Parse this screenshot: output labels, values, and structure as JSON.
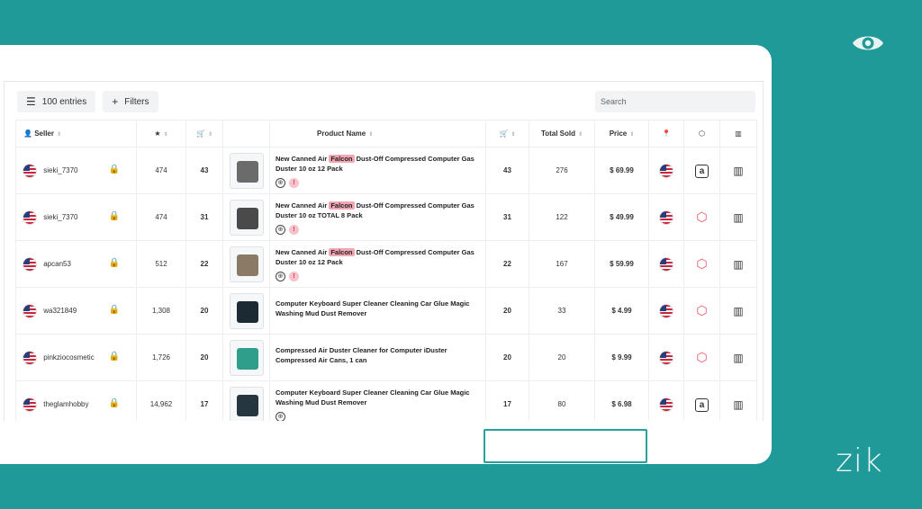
{
  "toolbar": {
    "entries_label": "100 entries",
    "filters_label": "Filters",
    "search_placeholder": "Search"
  },
  "columns": {
    "seller": "Seller",
    "product": "Product Name",
    "total_sold": "Total Sold",
    "price": "Price"
  },
  "rows": [
    {
      "seller": "sieki_7370",
      "rating": "474",
      "carts": "43",
      "title_pre": "New Canned Air ",
      "title_hl": "Falcon",
      "title_post": " Dust-Off Compressed Computer Gas Duster 10 oz 12 Pack",
      "sales": "43",
      "total_sold": "276",
      "price": "$ 69.99",
      "fulfillment": "amazon-icon",
      "badges": 2
    },
    {
      "seller": "sieki_7370",
      "rating": "474",
      "carts": "31",
      "title_pre": "New Canned Air ",
      "title_hl": "Falcon",
      "title_post": " Dust-Off Compressed Computer Gas Duster 10 oz TOTAL 8 Pack",
      "sales": "31",
      "total_sold": "122",
      "price": "$ 49.99",
      "fulfillment": "box-icon",
      "badges": 2
    },
    {
      "seller": "apcan53",
      "rating": "512",
      "carts": "22",
      "title_pre": "New Canned Air ",
      "title_hl": "Falcon",
      "title_post": " Dust-Off Compressed Computer Gas Duster 10 oz 12 Pack",
      "sales": "22",
      "total_sold": "167",
      "price": "$ 59.99",
      "fulfillment": "box-icon",
      "badges": 2
    },
    {
      "seller": "wa321849",
      "rating": "1,308",
      "carts": "20",
      "title_pre": "Computer Keyboard Super Cleaner Cleaning Car Glue Magic Washing Mud Dust Remover",
      "title_hl": "",
      "title_post": "",
      "sales": "20",
      "total_sold": "33",
      "price": "$ 4.99",
      "fulfillment": "box-icon",
      "badges": 0
    },
    {
      "seller": "pinkziocosmetic",
      "rating": "1,726",
      "carts": "20",
      "title_pre": "Compressed Air Duster Cleaner for Computer iDuster Compressed Air Cans, 1 can",
      "title_hl": "",
      "title_post": "",
      "sales": "20",
      "total_sold": "20",
      "price": "$ 9.99",
      "fulfillment": "box-icon",
      "badges": 0
    },
    {
      "seller": "theglamhobby",
      "rating": "14,962",
      "carts": "17",
      "title_pre": "Computer Keyboard Super Cleaner Cleaning Car Glue Magic Washing Mud Dust Remover",
      "title_hl": "",
      "title_post": "",
      "sales": "17",
      "total_sold": "80",
      "price": "$ 6.98",
      "fulfillment": "amazon-icon",
      "badges": 1
    }
  ],
  "brand": "zik",
  "colors": {
    "background": "#1f9a98",
    "highlight": "#f2a6b3",
    "accent_red": "#e34d64"
  }
}
